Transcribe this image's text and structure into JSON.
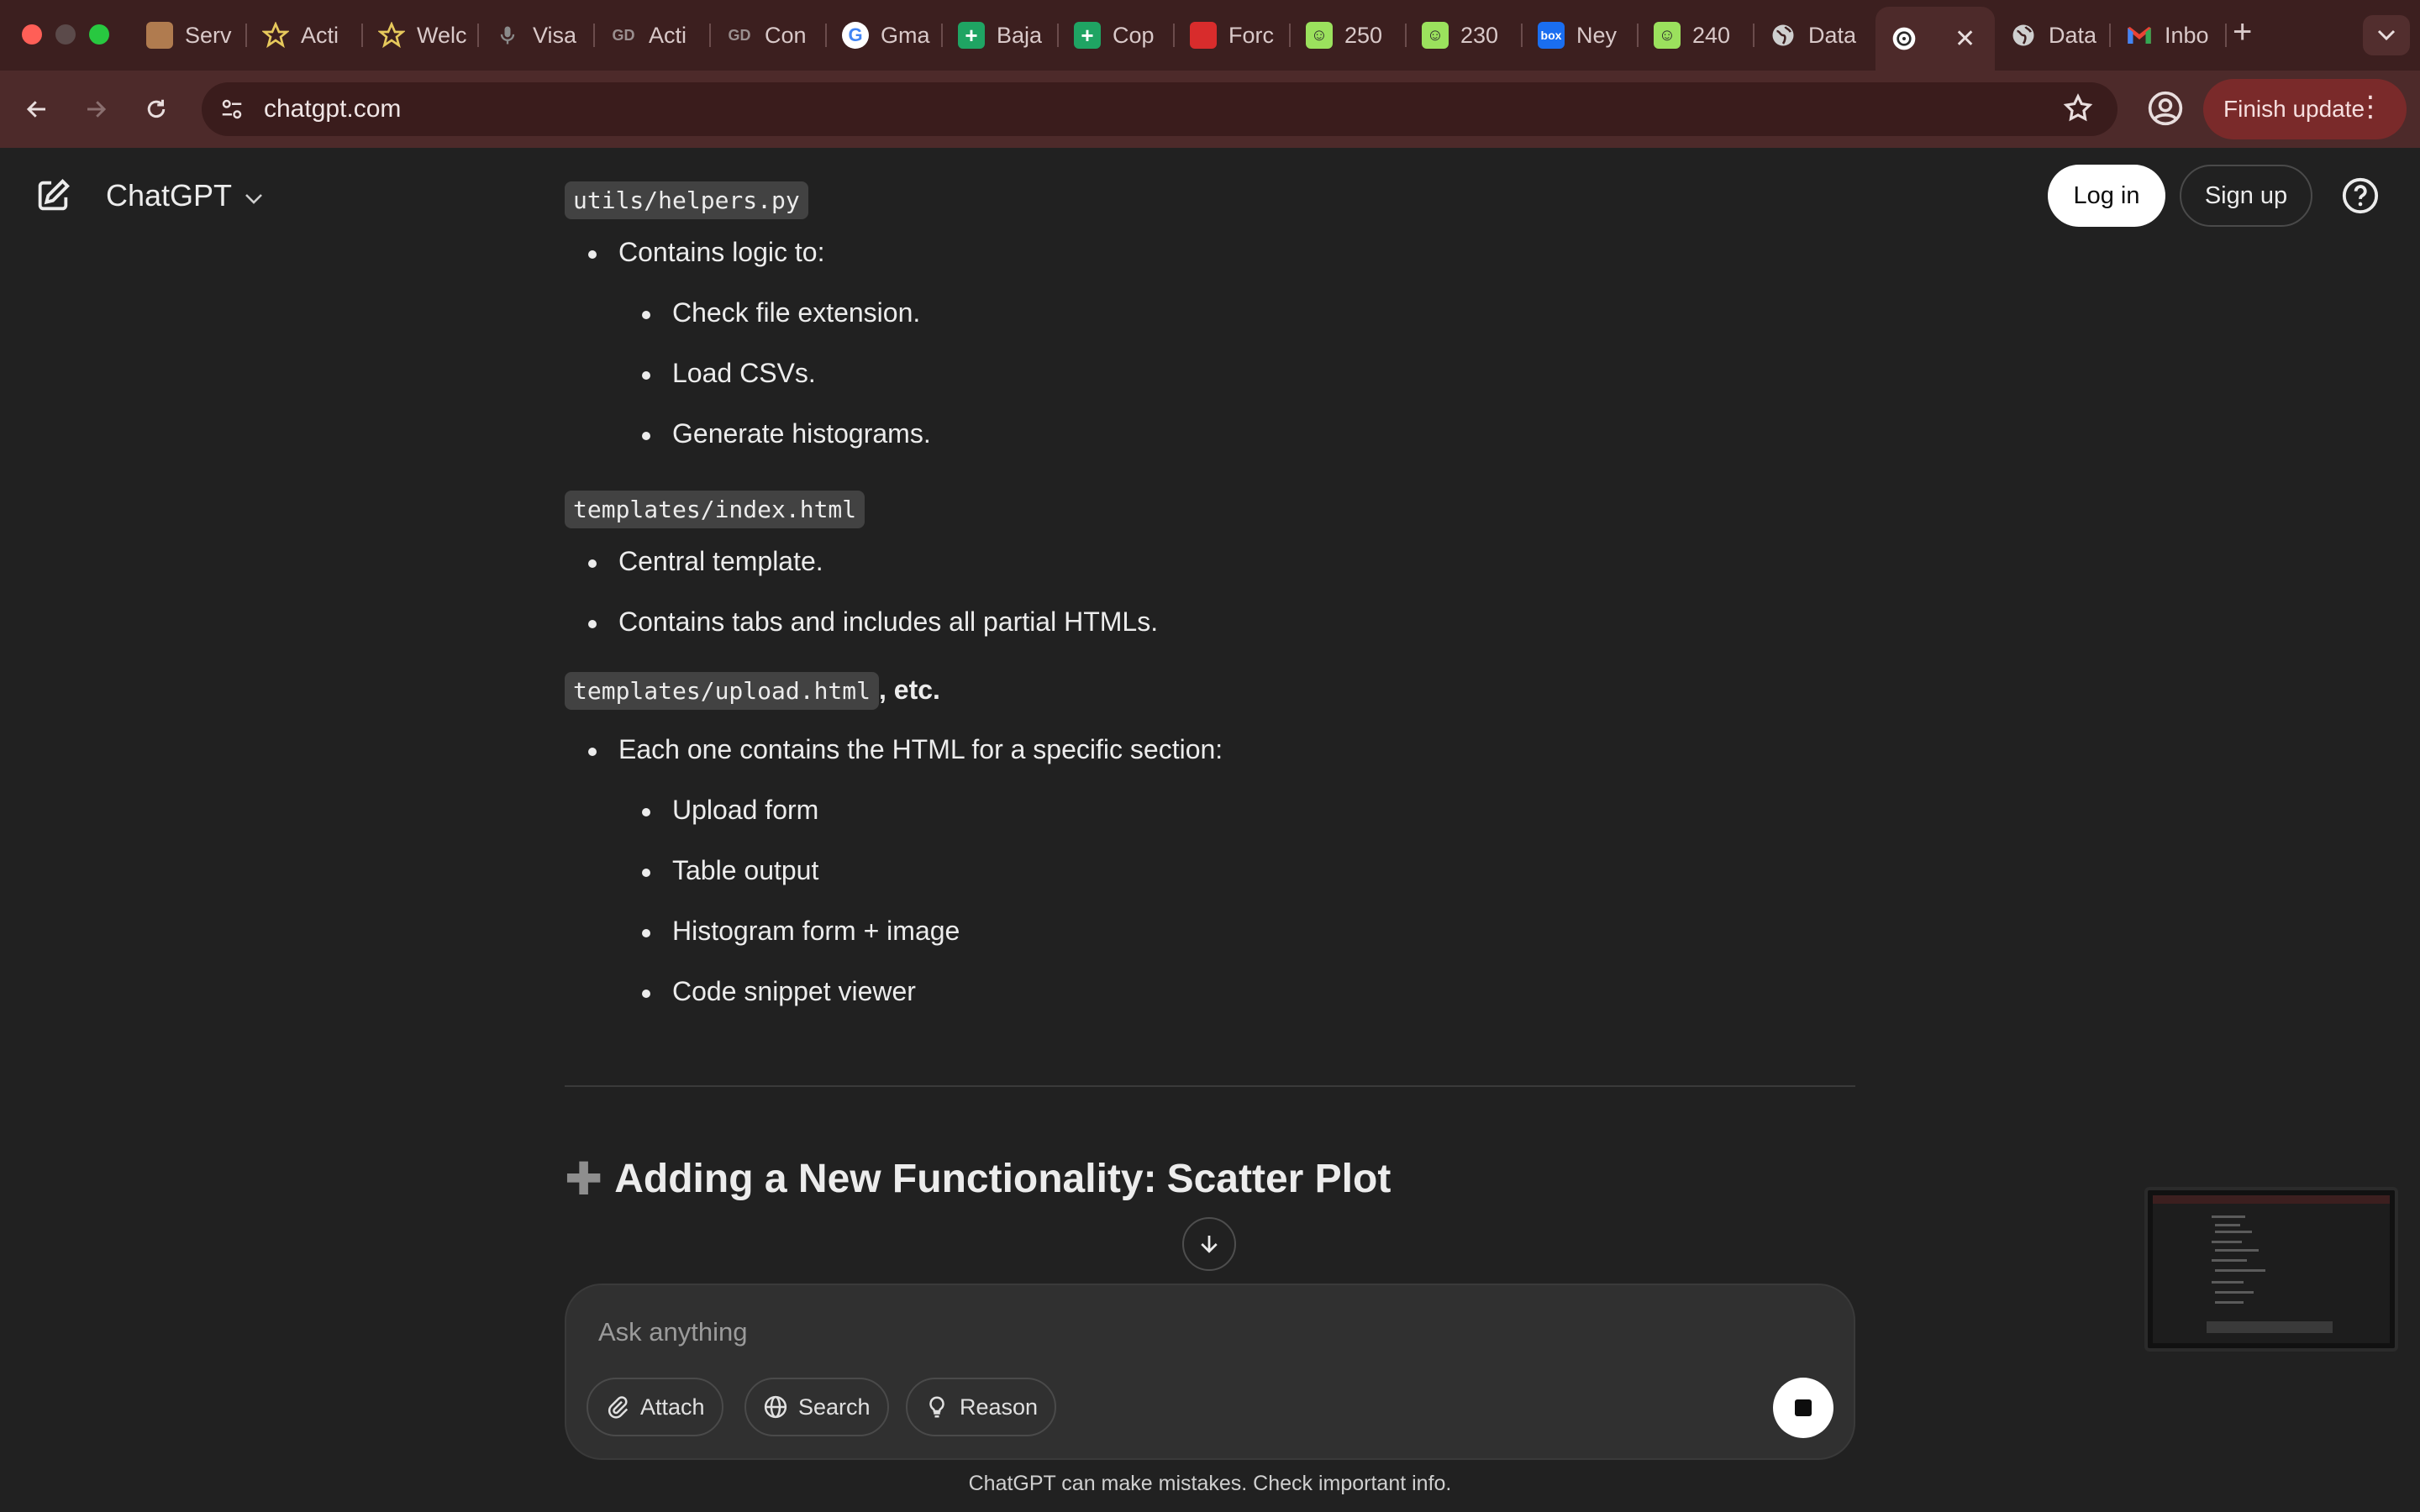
{
  "tabs": [
    {
      "label": "Serv",
      "icon": "shrine-icon",
      "color": "#b07b4f"
    },
    {
      "label": "Acti",
      "icon": "star-icon",
      "color": "#e7c95c"
    },
    {
      "label": "Welc",
      "icon": "star-icon",
      "color": "#e7c95c"
    },
    {
      "label": "Visa",
      "icon": "microphone-icon",
      "color": "#8a8a8a"
    },
    {
      "label": "Acti",
      "icon": "link-icon",
      "color": "#9a8f8f"
    },
    {
      "label": "Con",
      "icon": "link-icon",
      "color": "#9a8f8f"
    },
    {
      "label": "Gma",
      "icon": "google-icon",
      "color": "#ffffff"
    },
    {
      "label": "Baja",
      "icon": "sheets-plus-icon",
      "color": "#1fa463"
    },
    {
      "label": "Cop",
      "icon": "sheets-plus-icon",
      "color": "#1fa463"
    },
    {
      "label": "Forc",
      "icon": "red-logo-icon",
      "color": "#d82c2c"
    },
    {
      "label": "250",
      "icon": "smiley-icon",
      "color": "#9be15d"
    },
    {
      "label": "230",
      "icon": "smiley-icon",
      "color": "#9be15d"
    },
    {
      "label": "Ney",
      "icon": "box-icon",
      "color": "#1a6ef0"
    },
    {
      "label": "240",
      "icon": "smiley-icon",
      "color": "#9be15d"
    },
    {
      "label": "Data",
      "icon": "globe-icon",
      "color": "#cfcfcf"
    },
    {
      "label": "",
      "icon": "openai-icon",
      "color": "#ffffff",
      "active": true
    },
    {
      "label": "Data",
      "icon": "globe-icon",
      "color": "#cfcfcf"
    },
    {
      "label": "Inbo",
      "icon": "gmail-icon",
      "color": "#ea4335"
    }
  ],
  "browser": {
    "url": "chatgpt.com",
    "finish_update": "Finish update"
  },
  "header": {
    "brand": "ChatGPT",
    "login": "Log in",
    "signup": "Sign up"
  },
  "content": {
    "helpers_file": "utils/helpers.py",
    "helpers_intro": "Contains logic to:",
    "helpers_items": [
      "Check file extension.",
      "Load CSVs.",
      "Generate histograms."
    ],
    "index_file": "templates/index.html",
    "index_items": [
      "Central template.",
      "Contains tabs and includes all partial HTMLs."
    ],
    "upload_file": "templates/upload.html",
    "upload_suffix": ", etc.",
    "upload_intro": "Each one contains the HTML for a specific section:",
    "upload_items": [
      "Upload form",
      "Table output",
      "Histogram form + image",
      "Code snippet viewer"
    ],
    "heading_prefix": "Adding a New Functionality:",
    "heading_emphasis": "Scatter Plot"
  },
  "composer": {
    "placeholder": "Ask anything",
    "attach": "Attach",
    "search": "Search",
    "reason": "Reason"
  },
  "disclaimer": "ChatGPT can make mistakes. Check important info."
}
